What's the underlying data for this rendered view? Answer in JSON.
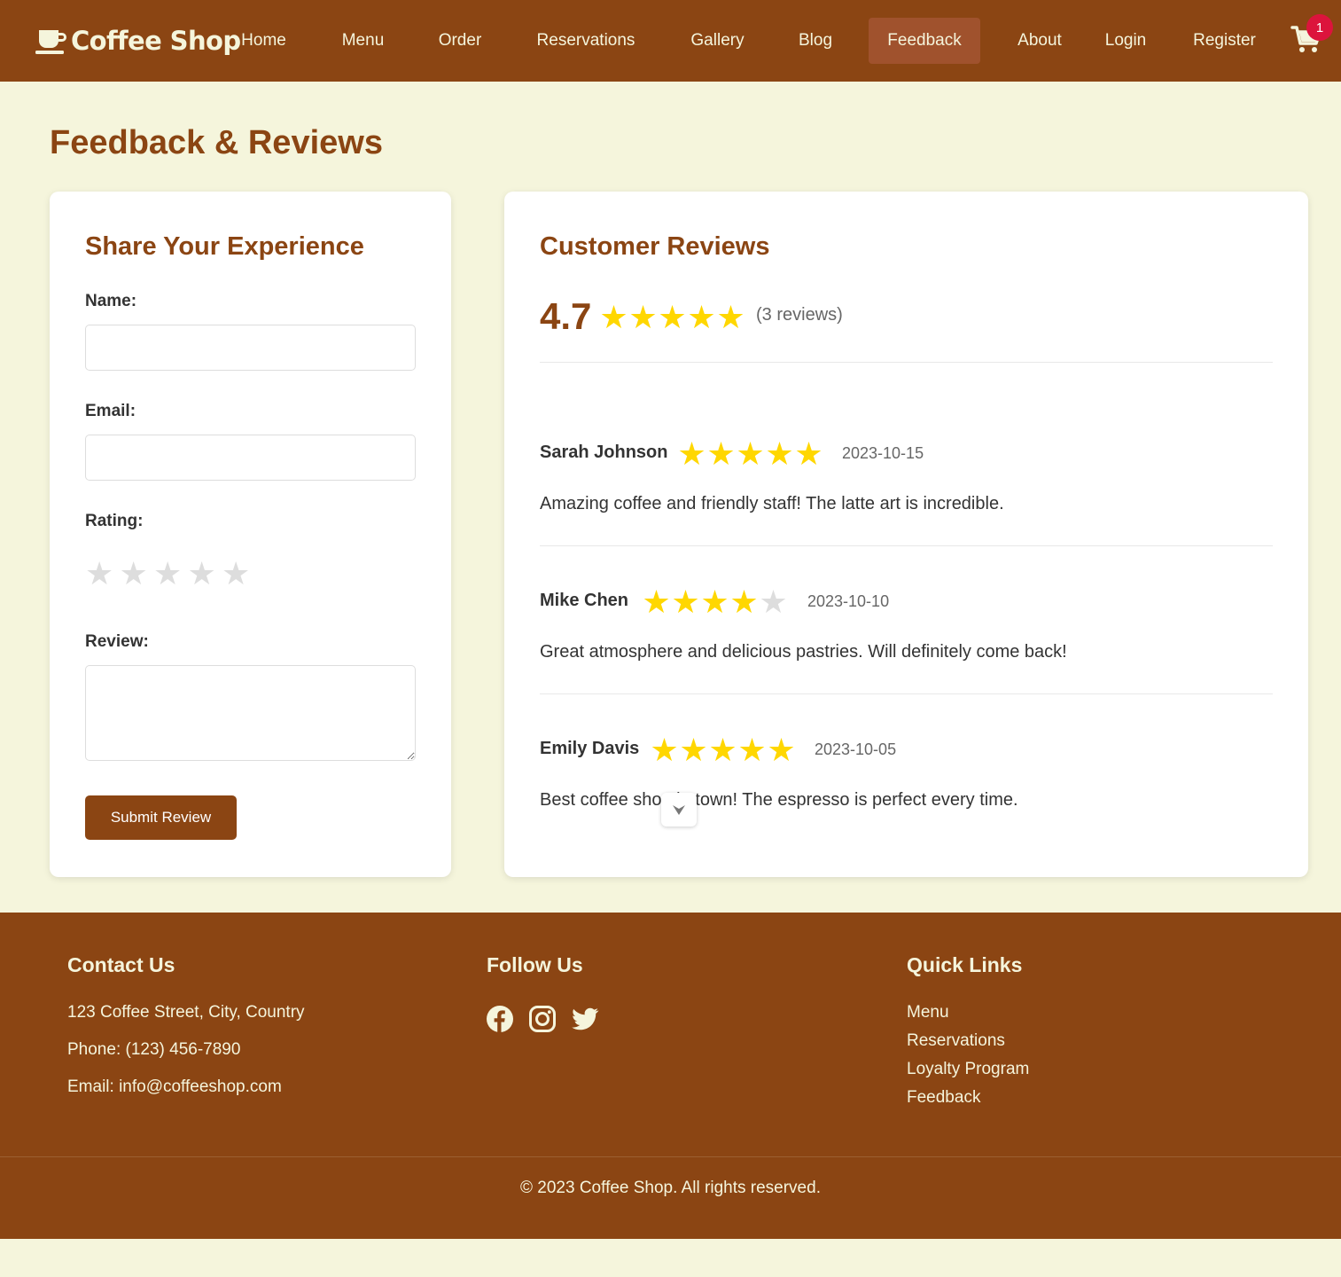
{
  "brand": {
    "name": "Coffee Shop",
    "icon": "coffee-cup-icon"
  },
  "nav": {
    "items": [
      {
        "label": "Home"
      },
      {
        "label": "Menu"
      },
      {
        "label": "Order"
      },
      {
        "label": "Reservations"
      },
      {
        "label": "Gallery"
      },
      {
        "label": "Blog"
      },
      {
        "label": "Feedback",
        "active": true
      },
      {
        "label": "About"
      },
      {
        "label": "Login"
      },
      {
        "label": "Register"
      }
    ],
    "cart": {
      "icon": "shopping-cart-icon",
      "count": "1"
    }
  },
  "page": {
    "title": "Feedback & Reviews"
  },
  "form": {
    "title": "Share Your Experience",
    "name_label": "Name:",
    "name_value": "",
    "email_label": "Email:",
    "email_value": "",
    "rating_label": "Rating:",
    "rating_value": 0,
    "rating_glyph": "★",
    "review_label": "Review:",
    "review_value": "",
    "submit_label": "Submit Review"
  },
  "reviews": {
    "title": "Customer Reviews",
    "average": "4.7",
    "average_stars": 5,
    "count_text": "(3 reviews)",
    "star_glyph": "★",
    "items": [
      {
        "name": "Sarah Johnson",
        "rating": 5,
        "date": "2023-10-15",
        "text": "Amazing coffee and friendly staff! The latte art is incredible."
      },
      {
        "name": "Mike Chen",
        "rating": 4,
        "date": "2023-10-10",
        "text": "Great atmosphere and delicious pastries. Will definitely come back!"
      },
      {
        "name": "Emily Davis",
        "rating": 5,
        "date": "2023-10-05",
        "text": "Best coffee shop in town! The espresso is perfect every time."
      }
    ]
  },
  "footer": {
    "contact": {
      "heading": "Contact Us",
      "address": "123 Coffee Street, City, Country",
      "phone": "Phone: (123) 456-7890",
      "email": "Email: info@coffeeshop.com"
    },
    "follow": {
      "heading": "Follow Us",
      "icons": [
        "facebook-icon",
        "instagram-icon",
        "twitter-icon"
      ]
    },
    "quick_links": {
      "heading": "Quick Links",
      "items": [
        "Menu",
        "Reservations",
        "Loyalty Program",
        "Feedback"
      ]
    },
    "copyright": "© 2023 Coffee Shop. All rights reserved."
  },
  "colors": {
    "brand": "#8b4513",
    "active_nav": "#a0522d",
    "background": "#f5f5dc",
    "star_on": "#ffd700",
    "star_off": "#dddddd",
    "badge": "#dc143c"
  }
}
